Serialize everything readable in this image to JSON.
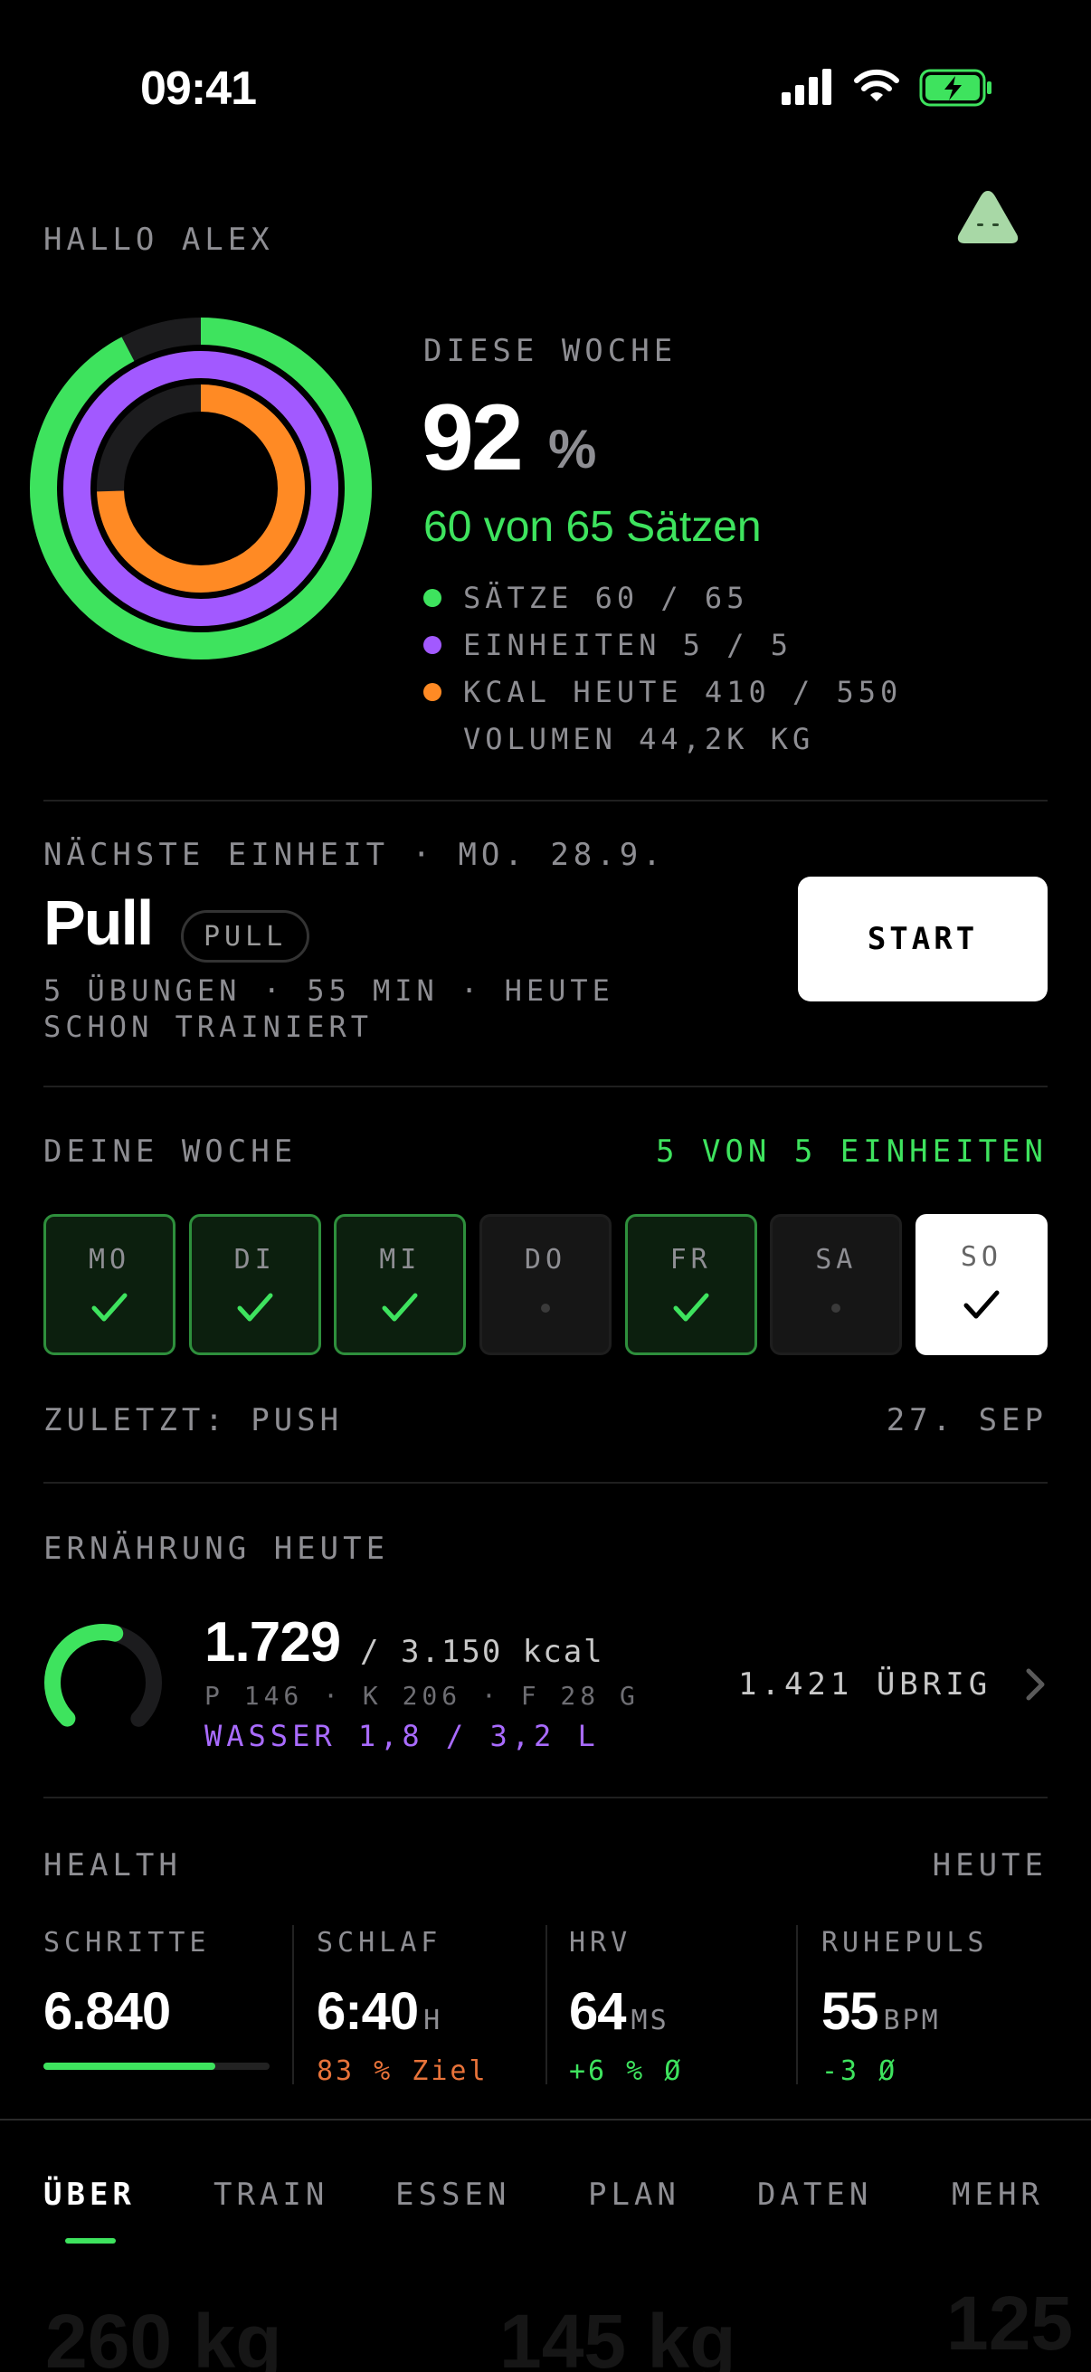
{
  "status": {
    "time": "09:41"
  },
  "header": {
    "greeting": "HALLO ALEX"
  },
  "week_summary": {
    "label": "DIESE WOCHE",
    "percent": "92",
    "percent_sign": "%",
    "sets_text": "60 von 65 Sätzen",
    "legend": [
      {
        "text": "SÄTZE 60 / 65",
        "color": "#3ee35e"
      },
      {
        "text": "EINHEITEN 5 / 5",
        "color": "#a259ff"
      },
      {
        "text": "KCAL HEUTE 410 / 550",
        "color": "#ff8a24"
      },
      {
        "text": "VOLUMEN 44,2K KG",
        "color": ""
      }
    ],
    "rings": {
      "sets_fraction": 0.923,
      "units_fraction": 1.0,
      "kcal_fraction": 0.745
    }
  },
  "next_session": {
    "label": "NÄCHSTE EINHEIT · MO. 28.9.",
    "title": "Pull",
    "badge": "PULL",
    "subtitle_line1": "5 ÜBUNGEN · 55 MIN · HEUTE",
    "subtitle_line2": "SCHON TRAINIERT",
    "start_label": "START"
  },
  "your_week": {
    "label": "DEINE WOCHE",
    "count": "5 VON 5 EINHEITEN",
    "days": [
      {
        "name": "MO",
        "state": "done"
      },
      {
        "name": "DI",
        "state": "done"
      },
      {
        "name": "MI",
        "state": "done"
      },
      {
        "name": "DO",
        "state": "rest"
      },
      {
        "name": "FR",
        "state": "done"
      },
      {
        "name": "SA",
        "state": "rest"
      },
      {
        "name": "SO",
        "state": "today"
      }
    ],
    "last_label": "ZULETZT: PUSH",
    "last_date": "27. SEP"
  },
  "nutrition": {
    "label": "ERNÄHRUNG HEUTE",
    "kcal": "1.729",
    "kcal_goal": "/ 3.150 kcal",
    "macros": "P 146 · K 206 · F 28 G",
    "water": "WASSER 1,8 / 3,2 L",
    "remaining": "1.421 ÜBRIG",
    "progress_fraction": 0.55
  },
  "health": {
    "label": "HEALTH",
    "today": "HEUTE",
    "metrics": [
      {
        "label": "SCHRITTE",
        "value": "6.840",
        "unit": "",
        "sub": "",
        "progress_fraction": 0.76
      },
      {
        "label": "SCHLAF",
        "value": "6:40",
        "unit": "H",
        "sub": "83 % Ziel",
        "sub_color": "#e8733a"
      },
      {
        "label": "HRV",
        "value": "64",
        "unit": "MS",
        "sub": "+6 % Ø",
        "sub_color": "#3ee35e"
      },
      {
        "label": "RUHEPULS",
        "value": "55",
        "unit": "BPM",
        "sub": "-3 Ø",
        "sub_color": "#3ee35e"
      }
    ]
  },
  "tabs": [
    "ÜBER",
    "TRAIN",
    "ESSEN",
    "PLAN",
    "DATEN",
    "MEHR"
  ],
  "background_peek": [
    "260 kg",
    "145 kg",
    "125"
  ]
}
